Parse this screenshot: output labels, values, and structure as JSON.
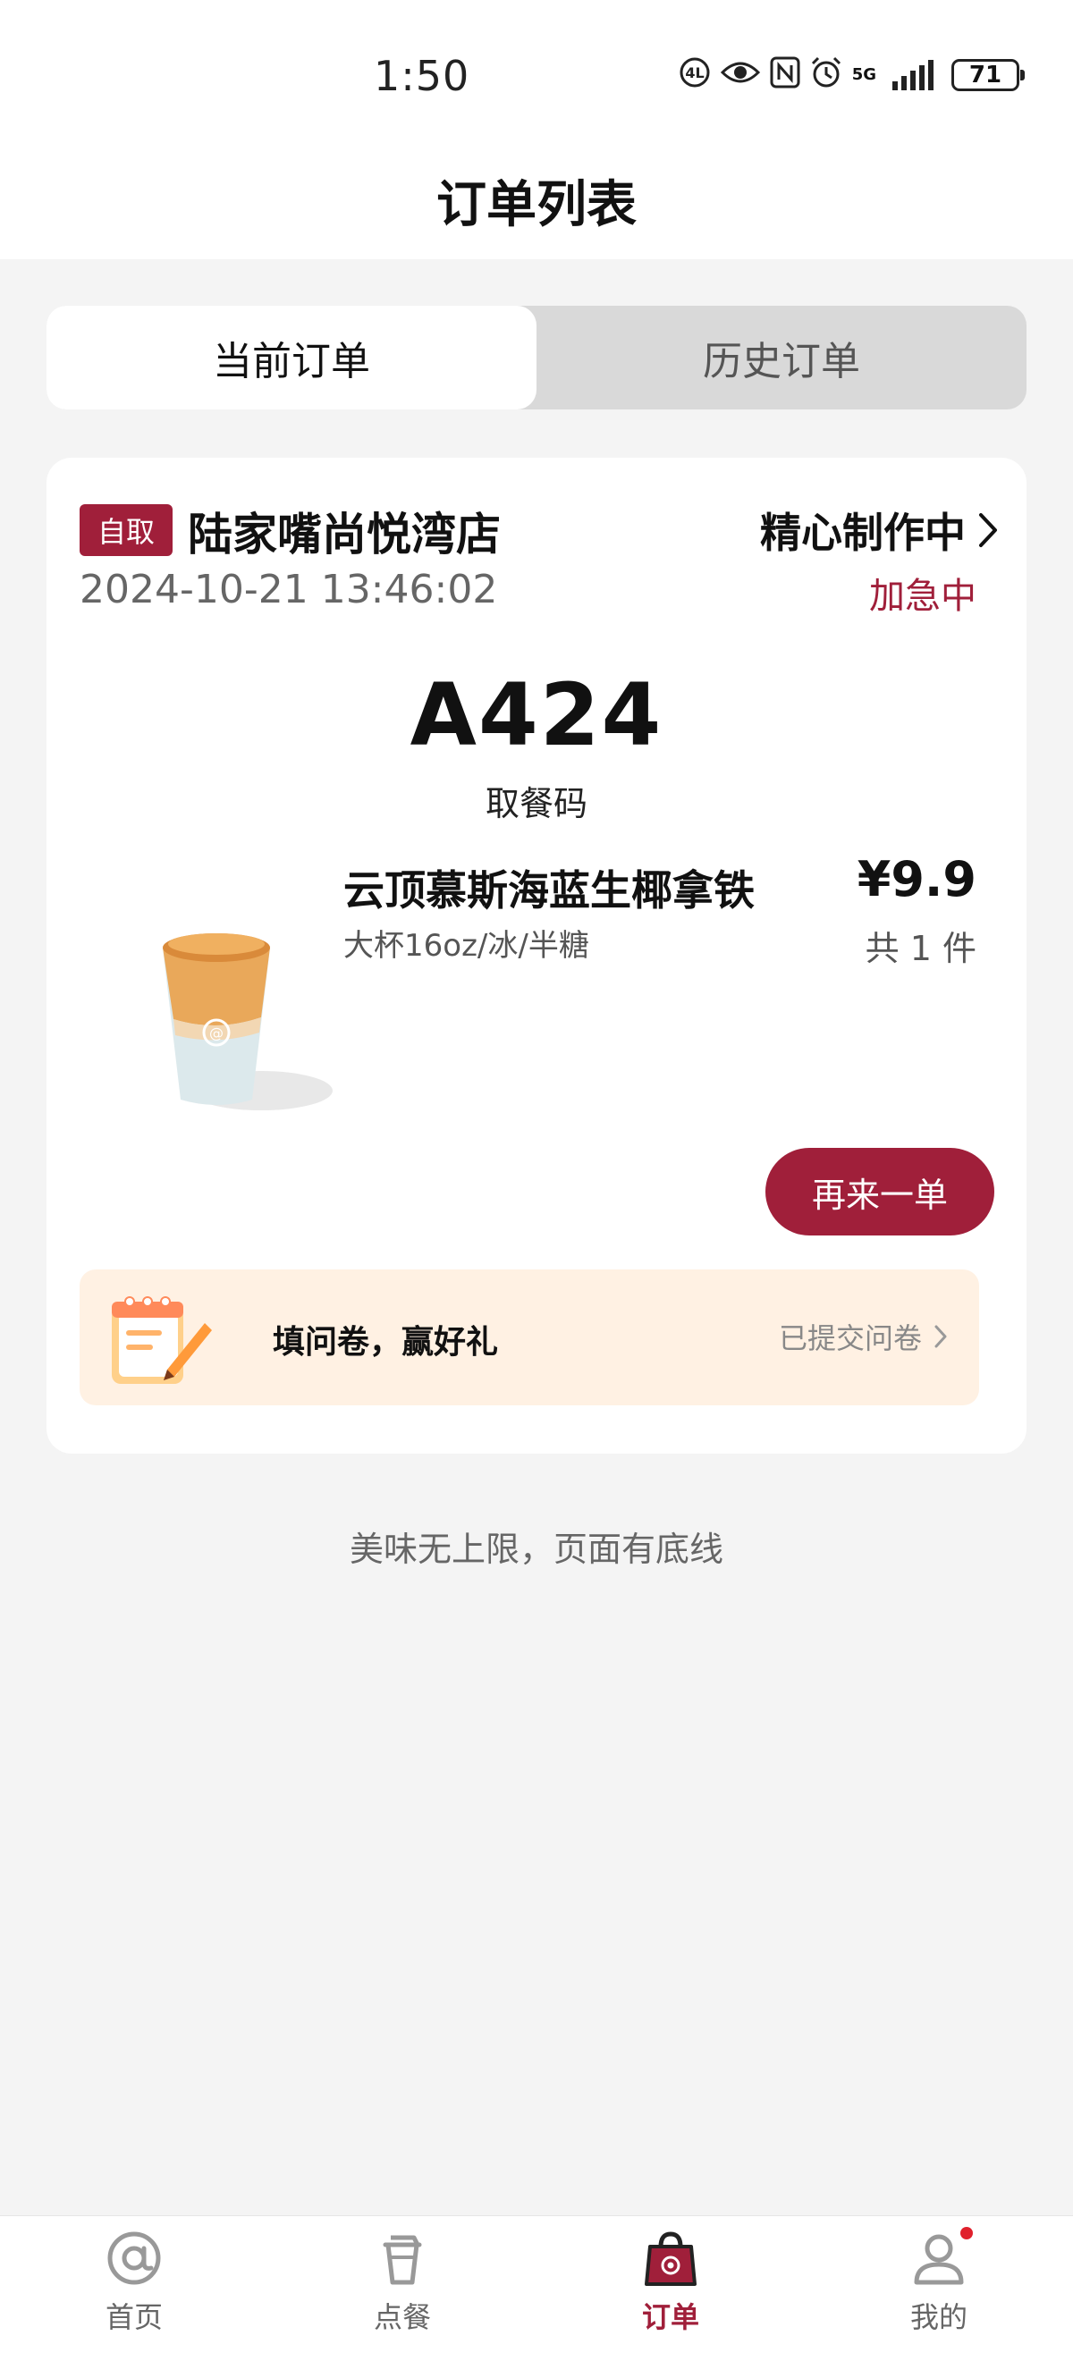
{
  "status_bar": {
    "time": "1:50",
    "network": "5G",
    "battery": "71"
  },
  "header": {
    "title": "订单列表"
  },
  "tabs": [
    {
      "label": "当前订单",
      "active": true
    },
    {
      "label": "历史订单",
      "active": false
    }
  ],
  "order": {
    "pickup_badge": "自取",
    "store_name": "陆家嘴尚悦湾店",
    "order_time": "2024-10-21 13:46:02",
    "status": "精心制作中",
    "rush_status": "加急中",
    "pickup_code": "A424",
    "pickup_code_label": "取餐码",
    "item": {
      "name": "云顶慕斯海蓝生椰拿铁",
      "spec": "大杯16oz/冰/半糖",
      "price": "¥9.9",
      "quantity": "共 1 件"
    },
    "reorder_label": "再来一单",
    "survey": {
      "text": "填问卷，赢好礼",
      "status": "已提交问卷"
    }
  },
  "footer_note": "美味无上限，页面有底线",
  "bottom_nav": [
    {
      "label": "首页",
      "icon": "home-at-icon"
    },
    {
      "label": "点餐",
      "icon": "cup-icon"
    },
    {
      "label": "订单",
      "icon": "order-bag-icon",
      "active": true
    },
    {
      "label": "我的",
      "icon": "profile-icon",
      "badge": true
    }
  ],
  "colors": {
    "brand": "#a01f3a",
    "survey_bg": "#fff1e3",
    "page_bg": "#f4f4f4"
  }
}
